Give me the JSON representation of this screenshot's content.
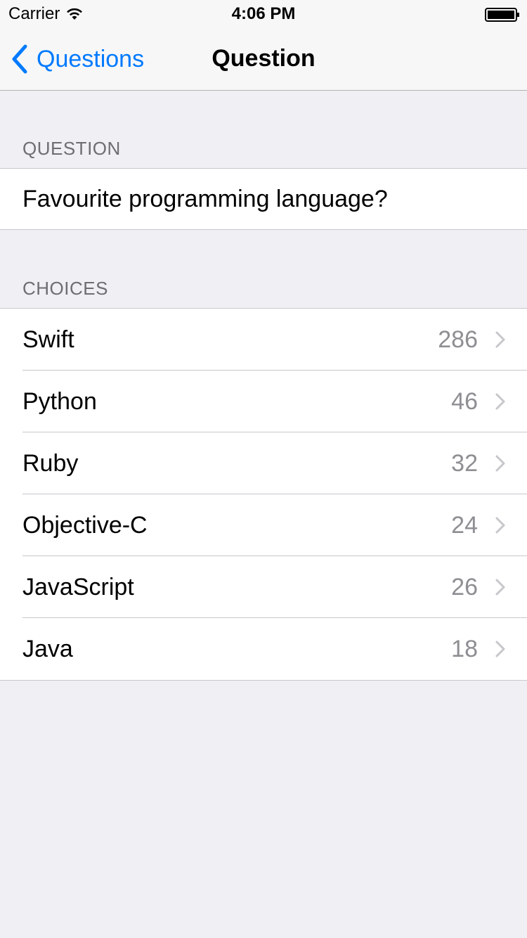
{
  "status_bar": {
    "carrier": "Carrier",
    "time": "4:06 PM"
  },
  "nav": {
    "back_label": "Questions",
    "title": "Question"
  },
  "question_section": {
    "header": "QUESTION",
    "text": "Favourite programming language?"
  },
  "choices_section": {
    "header": "CHOICES",
    "items": [
      {
        "label": "Swift",
        "votes": "286"
      },
      {
        "label": "Python",
        "votes": "46"
      },
      {
        "label": "Ruby",
        "votes": "32"
      },
      {
        "label": "Objective-C",
        "votes": "24"
      },
      {
        "label": "JavaScript",
        "votes": "26"
      },
      {
        "label": "Java",
        "votes": "18"
      }
    ]
  },
  "colors": {
    "tint": "#007aff",
    "background": "#efeff4",
    "secondary_text": "#8e8e93",
    "section_header_text": "#6d6d72"
  },
  "icons": {
    "wifi": "wifi-icon",
    "battery": "battery-icon",
    "back": "chevron-left-icon",
    "disclosure": "chevron-right-icon"
  }
}
